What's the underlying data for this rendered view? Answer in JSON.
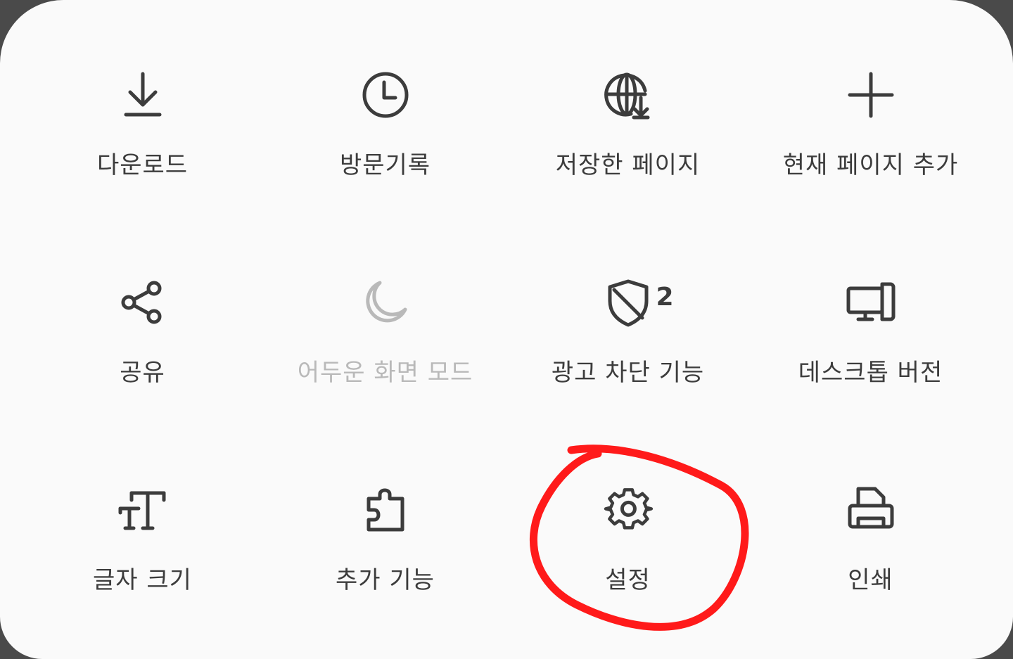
{
  "menu": {
    "items": [
      {
        "label": "다운로드",
        "icon": "download-icon"
      },
      {
        "label": "방문기록",
        "icon": "clock-icon"
      },
      {
        "label": "저장한 페이지",
        "icon": "globe-download-icon"
      },
      {
        "label": "현재 페이지 추가",
        "icon": "plus-icon"
      },
      {
        "label": "공유",
        "icon": "share-icon"
      },
      {
        "label": "어두운 화면 모드",
        "icon": "moon-icon"
      },
      {
        "label": "광고 차단 기능",
        "icon": "shield-icon",
        "badge": "2"
      },
      {
        "label": "데스크톱 버전",
        "icon": "desktop-icon"
      },
      {
        "label": "글자 크기",
        "icon": "text-size-icon"
      },
      {
        "label": "추가 기능",
        "icon": "puzzle-icon"
      },
      {
        "label": "설정",
        "icon": "gear-icon"
      },
      {
        "label": "인쇄",
        "icon": "printer-icon"
      }
    ]
  },
  "colors": {
    "icon": "#3c3c3c",
    "disabled": "#b9b9b9",
    "annotation": "#ff1a1a",
    "background": "#fafafa"
  }
}
